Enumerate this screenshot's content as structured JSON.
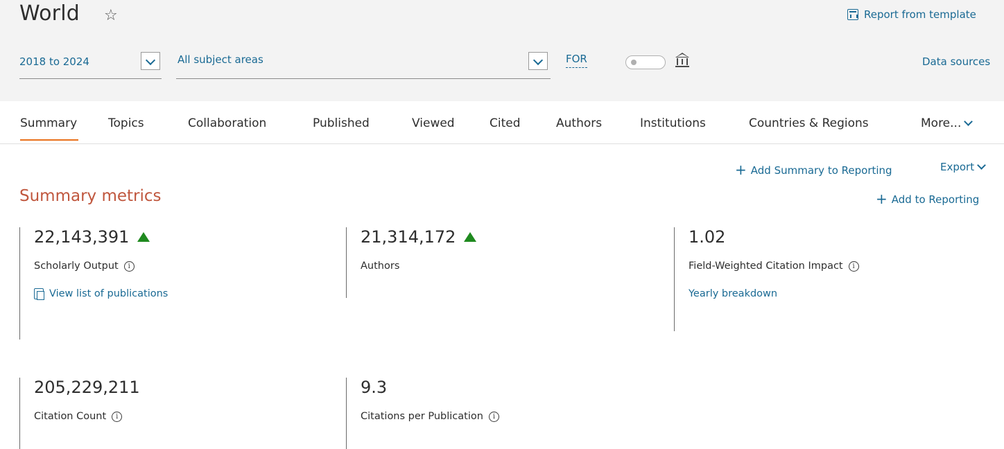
{
  "header": {
    "title": "World",
    "star_icon": "☆",
    "report_template_label": "Report from template"
  },
  "filters": {
    "year_range": "2018 to 2024",
    "subject_areas": "All subject areas",
    "for_label": "FOR",
    "data_sources_label": "Data sources"
  },
  "tabs": [
    {
      "label": "Summary",
      "active": true
    },
    {
      "label": "Topics"
    },
    {
      "label": "Collaboration"
    },
    {
      "label": "Published"
    },
    {
      "label": "Viewed"
    },
    {
      "label": "Cited"
    },
    {
      "label": "Authors"
    },
    {
      "label": "Institutions"
    },
    {
      "label": "Countries & Regions"
    },
    {
      "label": "More..."
    }
  ],
  "actions": {
    "add_summary_label": "Add Summary to Reporting",
    "export_label": "Export",
    "add_to_reporting_label": "Add to Reporting"
  },
  "section": {
    "title": "Summary metrics"
  },
  "metrics": {
    "scholarly_output": {
      "value": "22,143,391",
      "label": "Scholarly Output",
      "trend": "up",
      "link": "View list of publications"
    },
    "authors": {
      "value": "21,314,172",
      "label": "Authors",
      "trend": "up"
    },
    "fwci": {
      "value": "1.02",
      "label": "Field-Weighted Citation Impact",
      "link": "Yearly breakdown"
    },
    "citation_count": {
      "value": "205,229,211",
      "label": "Citation Count"
    },
    "citations_per_pub": {
      "value": "9.3",
      "label": "Citations per Publication"
    }
  },
  "colors": {
    "link": "#1a6a94",
    "accent_orange": "#e9711c",
    "section_title": "#c0573e",
    "trend_up": "#1f8a1f",
    "header_bg": "#f3f3f3"
  }
}
